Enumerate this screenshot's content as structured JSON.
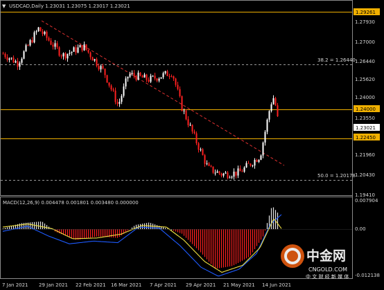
{
  "main_header": {
    "arrow": "▼",
    "text": "USDCAD,Daily  1.23031 1.23075 1.23017 1.23021"
  },
  "macd_header": {
    "text": "MACD(12,26,9) 0.004478 0.001801 0.003480 0.000000"
  },
  "price_axis": {
    "ticks": [
      "1.27930",
      "1.27000",
      "1.26440",
      "1.25620",
      "1.24000",
      "1.23550",
      "1.21960",
      "1.20430",
      "1.19410"
    ],
    "bubbles": [
      {
        "text": "1.29261",
        "style": "orange"
      },
      {
        "text": "1.24000",
        "style": "orange"
      },
      {
        "text": "1.23021",
        "style": "white"
      },
      {
        "text": "1.22450",
        "style": "orange"
      }
    ]
  },
  "macd_axis": {
    "ticks": [
      "0.007904",
      "0.00",
      "-0.012138"
    ]
  },
  "horizontal_levels": [
    {
      "price": 1.29261,
      "color": "#f0b000",
      "style": "solid"
    },
    {
      "price": 1.24,
      "color": "#f0b000",
      "style": "solid"
    },
    {
      "price": 1.2245,
      "color": "#f0b000",
      "style": "solid"
    },
    {
      "price": 1.2644,
      "color": "#9a9a9a",
      "style": "dashed",
      "label": "38.2 = 1.26440"
    },
    {
      "price": 1.20178,
      "color": "#9a9a9a",
      "style": "dashed",
      "label": "50.0 = 1.20178"
    }
  ],
  "dates": [
    "7 Jan 2021",
    "29 Jan 2021",
    "22 Feb 2021",
    "16 Mar 2021",
    "7 Apr 2021",
    "29 Apr 2021",
    "21 May 2021",
    "14 Jun 2021"
  ],
  "watermark": {
    "brand_cn": "中金网",
    "brand_en": "CNGOLD.COM",
    "tagline": "中 文 财 经 新 媒 体"
  },
  "colors": {
    "up_candle": "#ffffff",
    "down_candle": "#ff2020",
    "level": "#f0b000",
    "trendline": "#e03030",
    "macd_line": "#1e5bff",
    "signal_line": "#f0e040",
    "macd_pos": "#e6e6e6",
    "macd_neg": "#ff2020"
  },
  "chart_data": [
    {
      "type": "candlestick",
      "series_name": "USDCAD,Daily",
      "x": [
        "7 Jan 2021",
        "29 Jan 2021",
        "22 Feb 2021",
        "16 Mar 2021",
        "7 Apr 2021",
        "29 Apr 2021",
        "21 May 2021",
        "14 Jun 2021"
      ],
      "close": [
        1.272,
        1.278,
        1.264,
        1.247,
        1.259,
        1.215,
        1.206,
        1.233
      ],
      "last": {
        "open": 1.23031,
        "high": 1.23075,
        "low": 1.23017,
        "close": 1.23021
      },
      "ylim": [
        1.1941,
        1.2926
      ]
    },
    {
      "type": "line",
      "series_name": "MACD(12,26,9)",
      "x": [
        "7 Jan 2021",
        "29 Jan 2021",
        "22 Feb 2021",
        "16 Mar 2021",
        "7 Apr 2021",
        "29 Apr 2021",
        "21 May 2021",
        "14 Jun 2021"
      ],
      "series": [
        {
          "name": "MACD",
          "values": [
            0.0005,
            0.0012,
            -0.0025,
            -0.0015,
            0.002,
            -0.004,
            -0.01,
            0.0045
          ]
        },
        {
          "name": "Signal",
          "values": [
            0.0008,
            0.001,
            -0.002,
            -0.0018,
            0.001,
            -0.003,
            -0.0095,
            0.0018
          ]
        }
      ],
      "ylim": [
        -0.012138,
        0.007904
      ]
    }
  ]
}
